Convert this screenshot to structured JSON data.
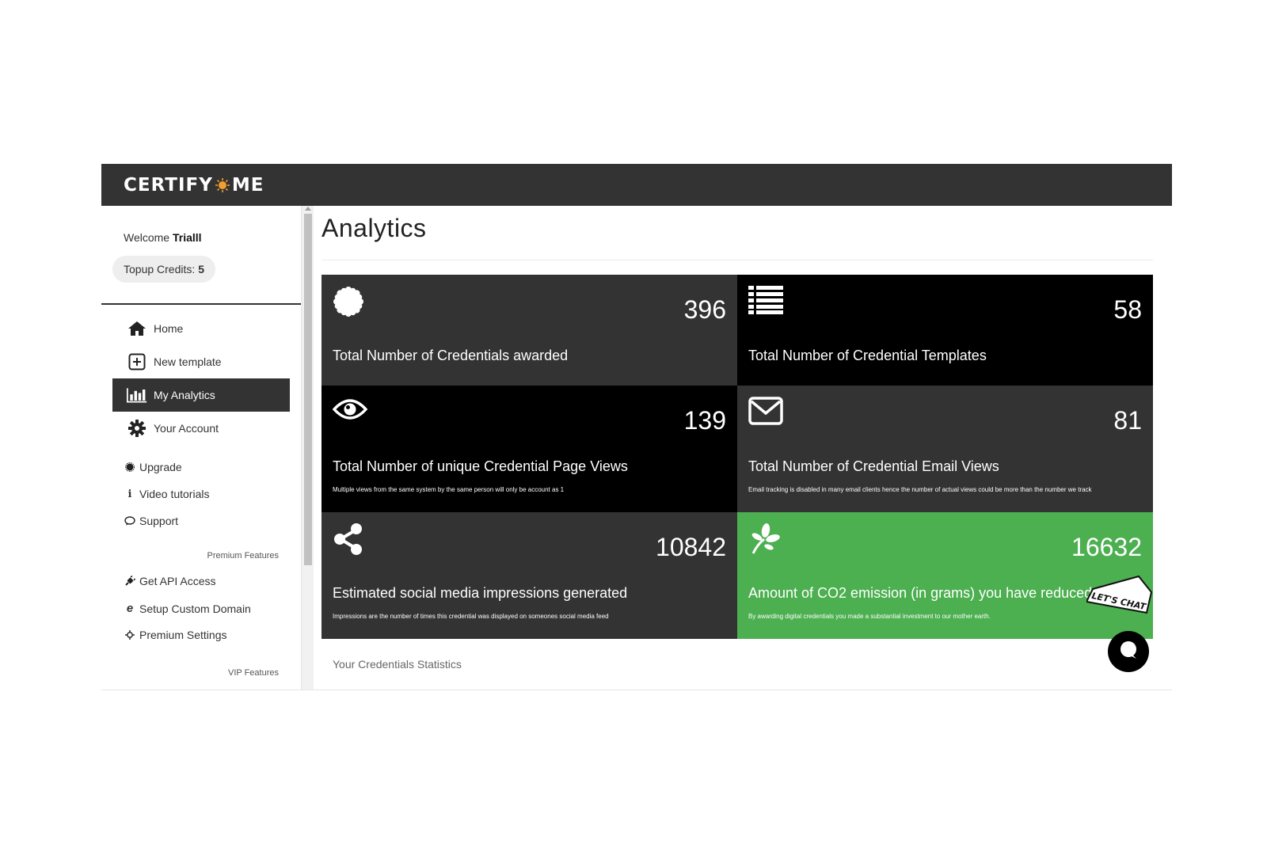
{
  "header": {
    "logo_left": "CERTIFY",
    "logo_right": "ME"
  },
  "sidebar": {
    "welcome_prefix": "Welcome",
    "user_name": "Trialll",
    "credits_label": "Topup Credits:",
    "credits_value": "5",
    "nav": [
      {
        "label": "Home",
        "icon": "home-icon"
      },
      {
        "label": "New template",
        "icon": "plus-square-icon"
      },
      {
        "label": "My Analytics",
        "icon": "bar-chart-icon",
        "active": true
      },
      {
        "label": "Your Account",
        "icon": "gear-icon"
      }
    ],
    "sub": [
      {
        "label": "Upgrade",
        "icon": "badge-icon"
      },
      {
        "label": "Video tutorials",
        "icon": "info-icon"
      },
      {
        "label": "Support",
        "icon": "comment-icon"
      }
    ],
    "premium_label": "Premium Features",
    "premium": [
      {
        "label": "Get API Access",
        "icon": "plug-icon"
      },
      {
        "label": "Setup Custom Domain",
        "icon": "internet-explorer-icon"
      },
      {
        "label": "Premium Settings",
        "icon": "crosshair-icon"
      }
    ],
    "vip_label": "VIP Features"
  },
  "main": {
    "title": "Analytics",
    "cards": [
      {
        "value": "396",
        "label": "Total Number of Credentials awarded",
        "note": "",
        "icon": "certificate-icon"
      },
      {
        "value": "58",
        "label": "Total Number of Credential Templates",
        "note": "",
        "icon": "list-icon"
      },
      {
        "value": "139",
        "label": "Total Number of unique Credential Page Views",
        "note": "Multiple views from the same system by the same person will only be account as 1",
        "icon": "eye-icon"
      },
      {
        "value": "81",
        "label": "Total Number of Credential Email Views",
        "note": "Email tracking is disabled in many email clients hence the number of actual views could be more than the number we track",
        "icon": "envelope-icon"
      },
      {
        "value": "10842",
        "label": "Estimated social media impressions generated",
        "note": "Impressions are the number of times this credential was displayed on someones social media feed",
        "icon": "share-icon"
      },
      {
        "value": "16632",
        "label": "Amount of CO2 emission (in grams) you have reduced",
        "note": "By awarding digital credentials you made a substantial investment to our mother earth.",
        "icon": "leaf-icon"
      }
    ],
    "stats_label": "Your Credentials Statistics"
  },
  "chat": {
    "tag": "LET'S CHAT"
  },
  "colors": {
    "dark": "#333333",
    "black": "#000000",
    "green": "#4caf50",
    "accent": "#f0a030"
  }
}
